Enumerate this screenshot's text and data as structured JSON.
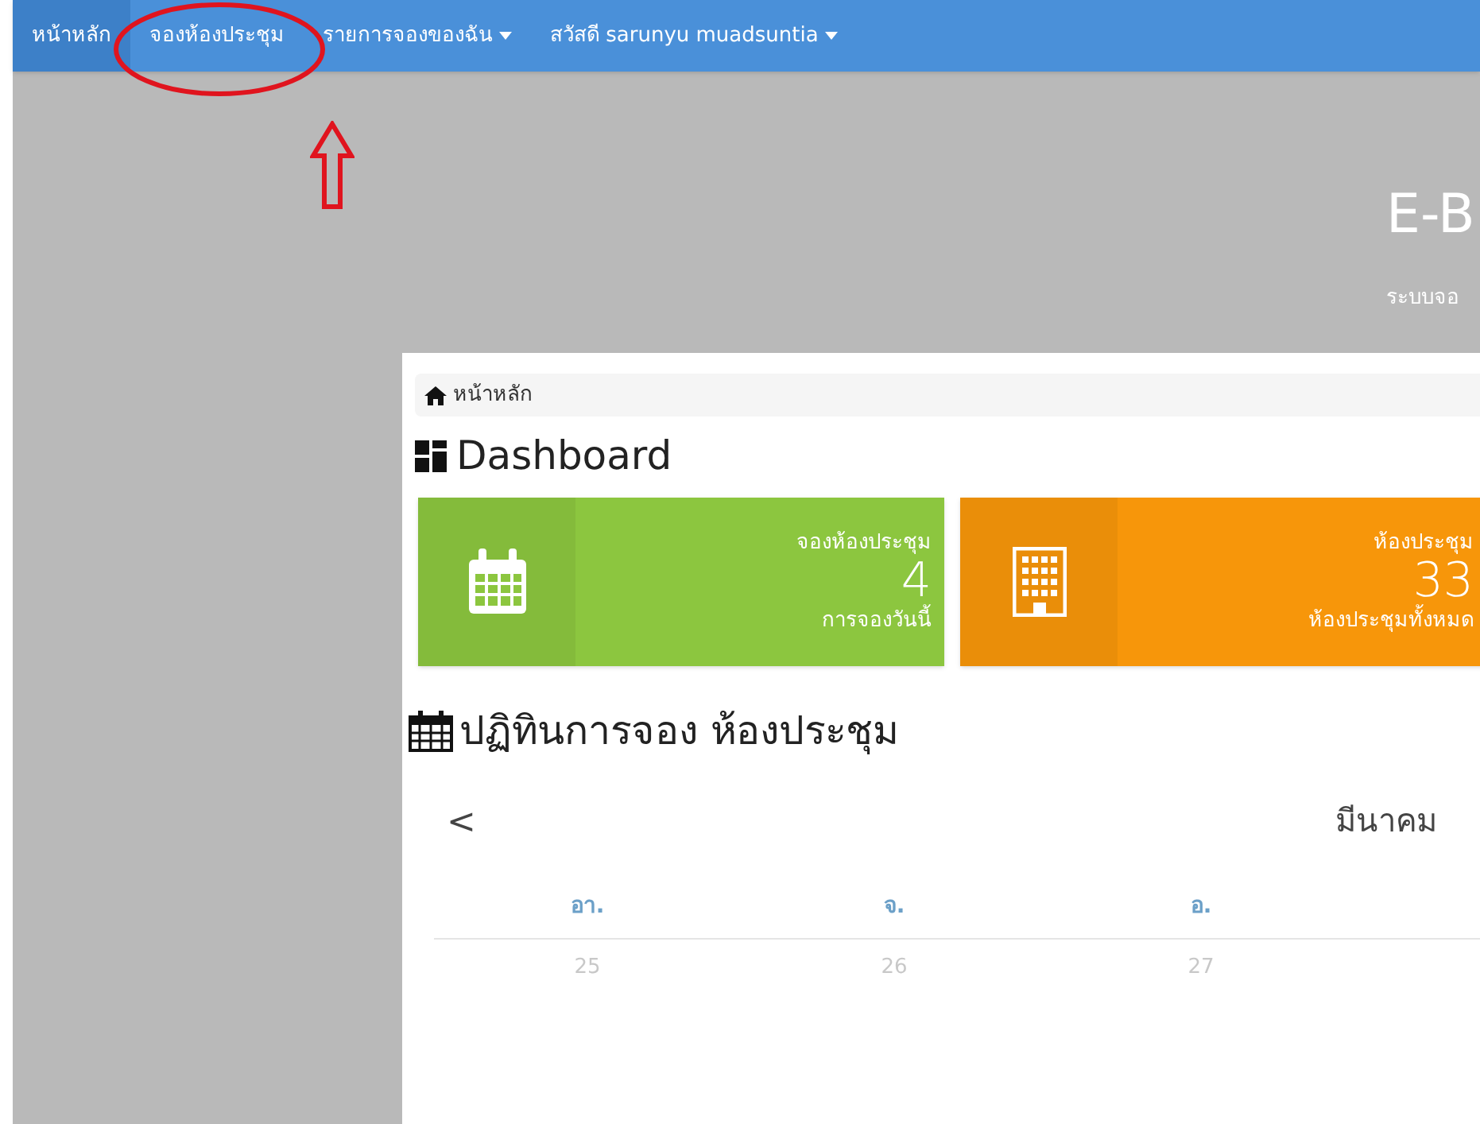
{
  "navbar": {
    "items": [
      {
        "label": "หน้าหลัก",
        "selected": true,
        "dropdown": false
      },
      {
        "label": "จองห้องประชุม",
        "selected": false,
        "dropdown": false
      },
      {
        "label": "รายการจองของฉัน",
        "selected": false,
        "dropdown": true
      },
      {
        "label": "สวัสดี sarunyu muadsuntia",
        "selected": false,
        "dropdown": true
      }
    ]
  },
  "hero": {
    "title": "E-B",
    "subtitle": "ระบบจอ"
  },
  "breadcrumb": {
    "label": "หน้าหลัก"
  },
  "dashboard": {
    "title": "Dashboard",
    "cards": [
      {
        "kind": "calendar",
        "color": "#8cc63f",
        "label": "จองห้องประชุม",
        "value": "4",
        "caption": "การจองวันนี้"
      },
      {
        "kind": "building",
        "color": "#f7960a",
        "label": "ห้องประชุม",
        "value": "33",
        "caption": "ห้องประชุมทั้งหมด"
      }
    ]
  },
  "calendar": {
    "title": "ปฏิทินการจอง ห้องประชุม",
    "prev": "<",
    "month": "มีนาคม",
    "weekdays": [
      "อา.",
      "จ.",
      "อ."
    ],
    "days": [
      "25",
      "26",
      "27"
    ]
  }
}
